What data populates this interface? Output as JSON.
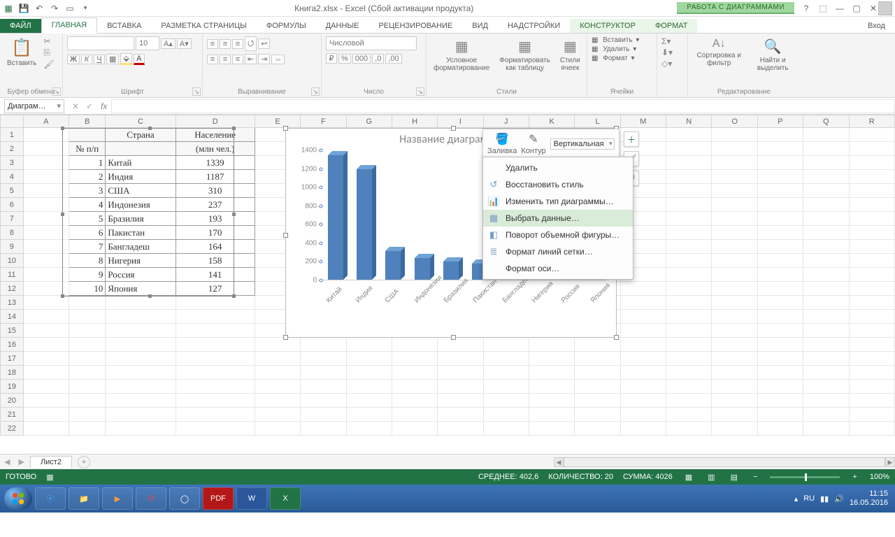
{
  "window": {
    "title": "Книга2.xlsx - Excel (Сбой активации продукта)",
    "chart_tools": "РАБОТА С ДИАГРАММАМИ",
    "signin": "Вход"
  },
  "tabs": {
    "file": "ФАЙЛ",
    "home": "ГЛАВНАЯ",
    "insert": "ВСТАВКА",
    "layout": "РАЗМЕТКА СТРАНИЦЫ",
    "formulas": "ФОРМУЛЫ",
    "data": "ДАННЫЕ",
    "review": "РЕЦЕНЗИРОВАНИЕ",
    "view": "ВИД",
    "addins": "НАДСТРОЙКИ",
    "design": "КОНСТРУКТОР",
    "format": "ФОРМАТ"
  },
  "ribbon": {
    "paste": "Вставить",
    "clipboard": "Буфер обмена",
    "font_group": "Шрифт",
    "font_size": "10",
    "align_group": "Выравнивание",
    "number_group": "Число",
    "number_format": "Числовой",
    "cond_fmt": "Условное форматирование",
    "fmt_table": "Форматировать как таблицу",
    "cell_styles": "Стили ячеек",
    "styles": "Стили",
    "ins": "Вставить",
    "del": "Удалить",
    "fmt": "Формат",
    "cells": "Ячейки",
    "sort": "Сортировка и фильтр",
    "find": "Найти и выделить",
    "editing": "Редактирование"
  },
  "namebox": "Диаграм…",
  "columns": [
    "A",
    "B",
    "C",
    "D",
    "E",
    "F",
    "G",
    "H",
    "I",
    "J",
    "K",
    "L",
    "M",
    "N",
    "O",
    "P",
    "Q",
    "R"
  ],
  "row_numbers": [
    1,
    2,
    3,
    4,
    5,
    6,
    7,
    8,
    9,
    10,
    11,
    12,
    13,
    14,
    15,
    16,
    17,
    18,
    19,
    20,
    21,
    22
  ],
  "table": {
    "h0": "№ п/п",
    "h1": "Страна",
    "h2": "Население (млн чел.)",
    "rows": [
      {
        "n": "1",
        "c": "Китай",
        "p": "1339"
      },
      {
        "n": "2",
        "c": "Индия",
        "p": "1187"
      },
      {
        "n": "3",
        "c": "США",
        "p": "310"
      },
      {
        "n": "4",
        "c": "Индонезия",
        "p": "237"
      },
      {
        "n": "5",
        "c": "Бразилия",
        "p": "193"
      },
      {
        "n": "6",
        "c": "Пакистан",
        "p": "170"
      },
      {
        "n": "7",
        "c": "Бангладеш",
        "p": "164"
      },
      {
        "n": "8",
        "c": "Нигерия",
        "p": "158"
      },
      {
        "n": "9",
        "c": "Россия",
        "p": "141"
      },
      {
        "n": "10",
        "c": "Япония",
        "p": "127"
      }
    ]
  },
  "chart_data": {
    "type": "bar",
    "title": "Название диаграммы",
    "categories": [
      "Китай",
      "Индия",
      "США",
      "Индонезия",
      "Бразилия",
      "Пакистан",
      "Бангладеш",
      "Нигерия",
      "Россия",
      "Япония"
    ],
    "values": [
      1339,
      1187,
      310,
      237,
      193,
      170,
      164,
      158,
      141,
      127
    ],
    "ylim": [
      0,
      1400
    ],
    "yticks": [
      0,
      200,
      400,
      600,
      800,
      1000,
      1200,
      1400
    ],
    "xlabel": "",
    "ylabel": ""
  },
  "minitb": {
    "fill": "Заливка",
    "outline": "Контур",
    "axis": "Вертикальная"
  },
  "context_menu": {
    "delete": "Удалить",
    "reset": "Восстановить стиль",
    "change_type": "Изменить тип диаграммы…",
    "select_data": "Выбрать данные…",
    "rotate3d": "Поворот объемной фигуры…",
    "gridlines": "Формат линий сетки…",
    "axis": "Формат оси…"
  },
  "sheet": {
    "name": "Лист2"
  },
  "status": {
    "ready": "ГОТОВО",
    "avg": "СРЕДНЕЕ: 402,6",
    "count": "КОЛИЧЕСТВО: 20",
    "sum": "СУММА: 4026",
    "zoom": "100%"
  },
  "tray": {
    "lang": "RU",
    "time": "11:15",
    "date": "16.05.2016"
  }
}
